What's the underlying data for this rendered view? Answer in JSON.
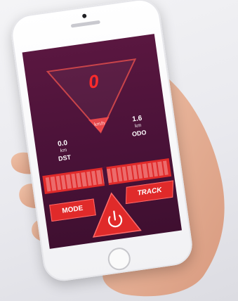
{
  "screen": {
    "speed": "0",
    "speed_unit": "km/h",
    "dst": {
      "value": "0.0",
      "unit": "km",
      "label": "DST"
    },
    "odo": {
      "value": "1.6",
      "unit": "km",
      "label": "ODO"
    }
  },
  "buttons": {
    "mode_label": "MODE",
    "track_label": "TRACK"
  },
  "colors": {
    "screen_bg": "#4a1238",
    "accent_red": "#e02a2a",
    "speed_red": "#ff2b2b"
  },
  "icons": {
    "power": "power-icon",
    "home": "home-button-icon",
    "status_left": "menu-icon",
    "status_right": "bluetooth-icon"
  }
}
